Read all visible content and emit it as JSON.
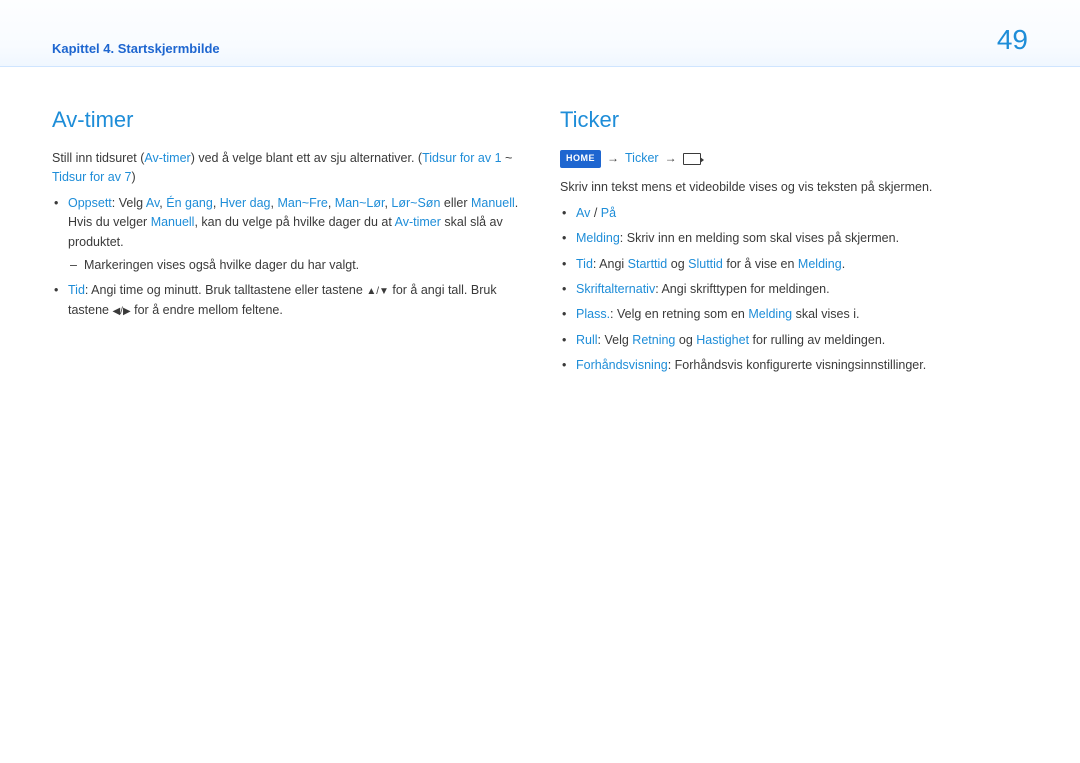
{
  "header": {
    "breadcrumb": "Kapittel 4. Startskjermbilde",
    "page_number": "49"
  },
  "left": {
    "title": "Av-timer",
    "intro_a": "Still inn tidsuret (",
    "intro_b": "Av-timer",
    "intro_c": ") ved å velge blant ett av sju alternativer. (",
    "intro_d": "Tidsur for av 1",
    "intro_e": " ~ ",
    "intro_f": "Tidsur for av 7",
    "intro_g": ")",
    "setup_label": "Oppsett",
    "setup_prefix": ": Velg ",
    "opt_off": "Av",
    "sep": ", ",
    "opt_once": "Én gang",
    "opt_everyday": "Hver dag",
    "opt_monfri": "Man~Fre",
    "opt_monsat": "Man~Lør",
    "opt_satsun": "Lør~Søn",
    "or": " eller ",
    "opt_manual": "Manuell",
    "dot": ".",
    "manual_a": "Hvis du velger ",
    "manual_b": "Manuell",
    "manual_c": ", kan du velge på hvilke dager du at ",
    "manual_d": "Av-timer",
    "manual_e": " skal slå av produktet.",
    "marking": "Markeringen vises også hvilke dager du har valgt.",
    "tid_label": "Tid",
    "tid_a": ": Angi time og minutt. Bruk talltastene eller tastene ",
    "tid_b": " for å angi tall. Bruk tastene ",
    "tid_c": " for å endre mellom feltene."
  },
  "right": {
    "title": "Ticker",
    "nav_home": "HOME",
    "nav_ticker": "Ticker",
    "intro": "Skriv inn tekst mens et videobilde vises og vis teksten på skjermen.",
    "av": "Av",
    "slash": " / ",
    "pa": "På",
    "melding_label": "Melding",
    "melding_text": ": Skriv inn en melding som skal vises på skjermen.",
    "tid_label": "Tid",
    "tid_a": ": Angi ",
    "tid_start": "Starttid",
    "tid_and": " og ",
    "tid_end": "Sluttid",
    "tid_b": " for å vise en ",
    "tid_c": "Melding",
    "skrift_label": "Skriftalternativ",
    "skrift_text": ": Angi skrifttypen for meldingen.",
    "plass_label": "Plass.",
    "plass_a": ": Velg en retning som en ",
    "plass_b": "Melding",
    "plass_c": " skal vises i.",
    "rull_label": "Rull",
    "rull_a": ": Velg ",
    "rull_dir": "Retning",
    "rull_and": " og ",
    "rull_speed": "Hastighet",
    "rull_b": " for rulling av meldingen.",
    "preview_label": "Forhåndsvisning",
    "preview_text": ": Forhåndsvis konfigurerte visningsinnstillinger."
  }
}
